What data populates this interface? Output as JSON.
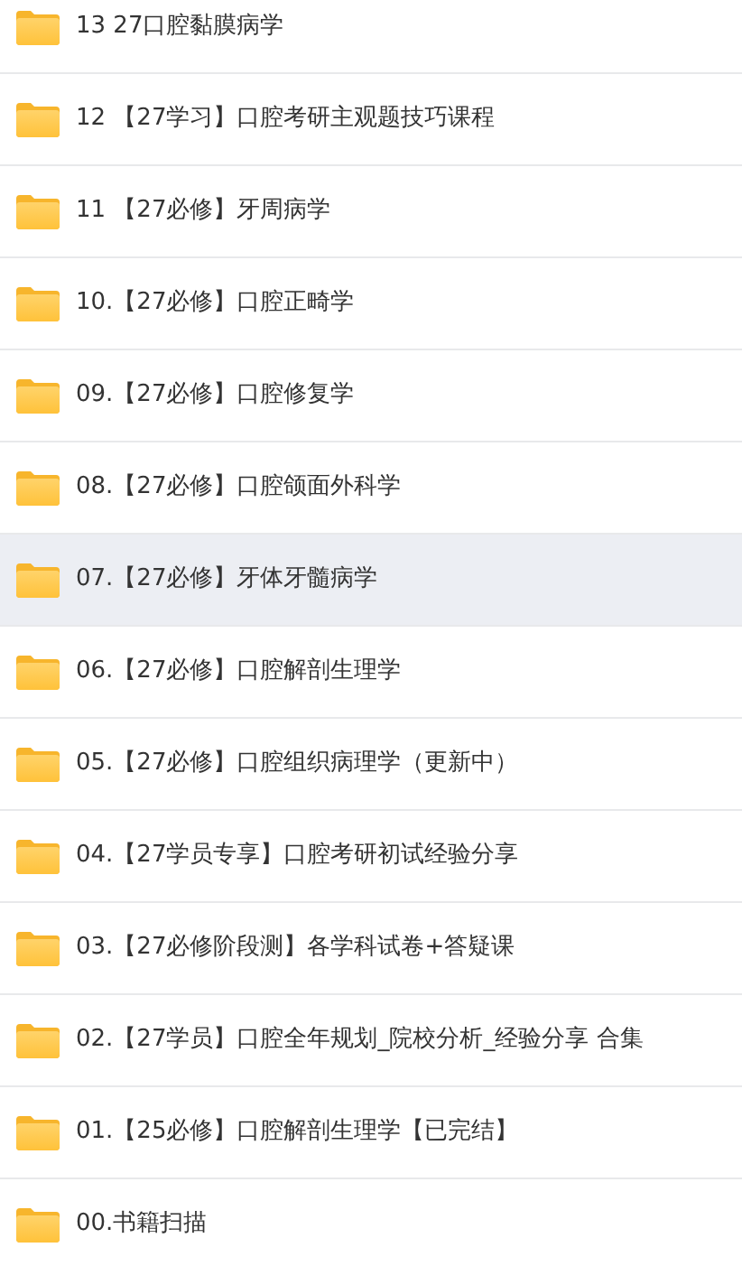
{
  "folders": [
    {
      "name": "13 27口腔黏膜病学",
      "selected": false
    },
    {
      "name": "12 【27学习】口腔考研主观题技巧课程",
      "selected": false
    },
    {
      "name": "11 【27必修】牙周病学",
      "selected": false
    },
    {
      "name": "10.【27必修】口腔正畸学",
      "selected": false
    },
    {
      "name": "09.【27必修】口腔修复学",
      "selected": false
    },
    {
      "name": "08.【27必修】口腔颌面外科学",
      "selected": false
    },
    {
      "name": "07.【27必修】牙体牙髓病学",
      "selected": true
    },
    {
      "name": "06.【27必修】口腔解剖生理学",
      "selected": false
    },
    {
      "name": "05.【27必修】口腔组织病理学（更新中）",
      "selected": false
    },
    {
      "name": "04.【27学员专享】口腔考研初试经验分享",
      "selected": false
    },
    {
      "name": "03.【27必修阶段测】各学科试卷+答疑课",
      "selected": false
    },
    {
      "name": "02.【27学员】口腔全年规划_院校分析_经验分享 合集",
      "selected": false
    },
    {
      "name": "01.【25必修】口腔解剖生理学【已完结】",
      "selected": false
    },
    {
      "name": "00.书籍扫描",
      "selected": false
    }
  ]
}
